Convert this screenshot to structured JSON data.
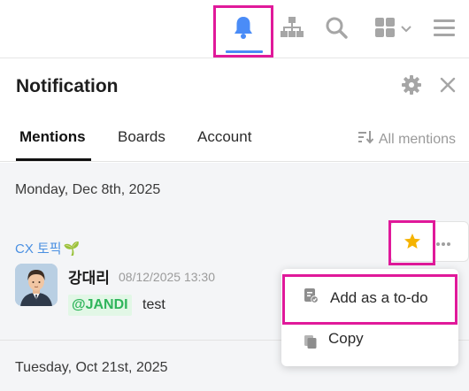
{
  "toolbar": {
    "icons": [
      "bell-icon",
      "org-chart-icon",
      "search-icon",
      "apps-grid-icon",
      "hamburger-menu-icon"
    ],
    "active_color": "#4a8cf7",
    "highlight_color": "#e0199a"
  },
  "panel": {
    "title": "Notification"
  },
  "tabs": [
    {
      "label": "Mentions",
      "active": true
    },
    {
      "label": "Boards",
      "active": false
    },
    {
      "label": "Account",
      "active": false
    }
  ],
  "filter": {
    "label": "All mentions"
  },
  "groups": [
    {
      "date": "Monday, Dec 8th, 2025",
      "items": [
        {
          "topic": "CX 토픽",
          "topic_emoji": "🌱",
          "sender": "강대리",
          "time": "08/12/2025 13:30",
          "mention": "@JANDI",
          "message": "test"
        }
      ]
    },
    {
      "date": "Tuesday, Oct 21st, 2025",
      "items": []
    }
  ],
  "context_menu": {
    "items": [
      {
        "label": "Add as a to-do",
        "icon": "todo-icon"
      },
      {
        "label": "Copy",
        "icon": "copy-icon"
      }
    ]
  },
  "colors": {
    "star": "#f5b301",
    "topic": "#4a90e2",
    "mention_text": "#2fb55b",
    "mention_bg": "#e2f7e6"
  }
}
